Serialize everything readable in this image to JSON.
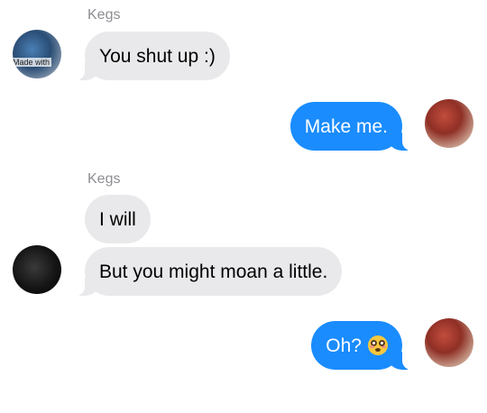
{
  "conversation": {
    "messages": [
      {
        "sender": "Kegs",
        "text": "You shut up :)",
        "direction": "incoming"
      },
      {
        "text": "Make me.",
        "direction": "outgoing"
      },
      {
        "sender": "Kegs",
        "text": "I will",
        "direction": "incoming"
      },
      {
        "text": "But you might moan a little.",
        "direction": "incoming"
      },
      {
        "text": "Oh?",
        "emoji": "flushed-face",
        "direction": "outgoing"
      }
    ]
  },
  "avatars": {
    "kegs_first_watermark": "Made with"
  },
  "colors": {
    "incoming_bubble": "#e9e9eb",
    "outgoing_bubble": "#1a8cfe",
    "sender_label": "#8e8e93"
  }
}
